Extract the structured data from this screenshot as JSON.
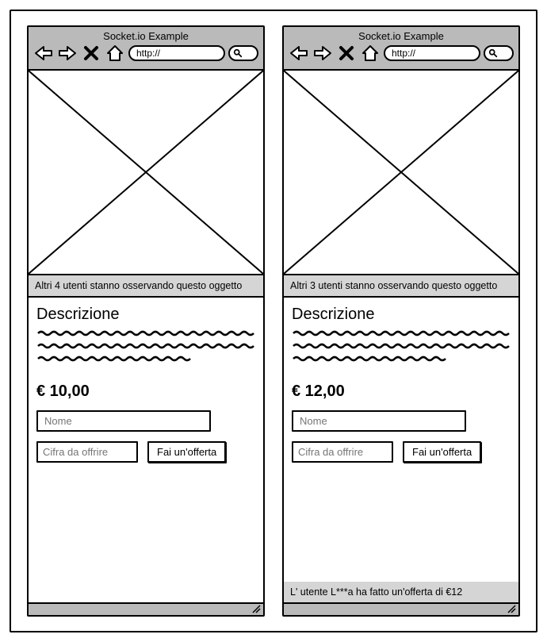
{
  "browser_title": "Socket.io Example",
  "url_value": "http://",
  "panels": [
    {
      "watching": "Altri 4 utenti stanno osservando questo oggetto",
      "desc_title": "Descrizione",
      "price": "€ 10,00",
      "name_placeholder": "Nome",
      "offer_placeholder": "Cifra da offrire",
      "offer_button": "Fai un'offerta",
      "notification": ""
    },
    {
      "watching": "Altri 3 utenti stanno osservando questo oggetto",
      "desc_title": "Descrizione",
      "price": "€ 12,00",
      "name_placeholder": "Nome",
      "offer_placeholder": "Cifra da offrire",
      "offer_button": "Fai un'offerta",
      "notification": "L' utente L***a ha fatto un'offerta di €12"
    }
  ]
}
